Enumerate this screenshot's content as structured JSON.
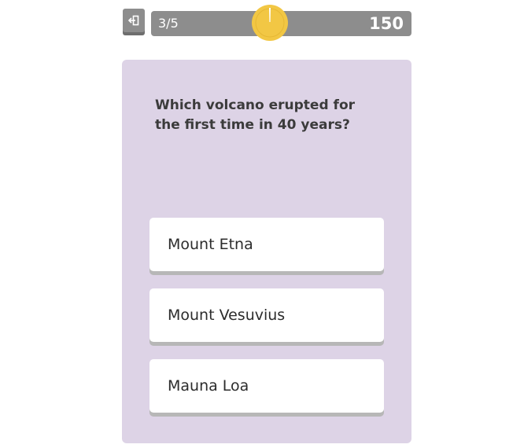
{
  "header": {
    "exit_icon": "exit-icon",
    "question_counter": "3/5",
    "score": "150",
    "timer_icon": "stopwatch-icon",
    "timer_color": "#f2c744",
    "bar_color": "#8d8d8d"
  },
  "question": {
    "text": "Which volcano erupted for the first time in 40 years?",
    "card_color": "#ddd3e6"
  },
  "answers": [
    {
      "label": "Mount Etna"
    },
    {
      "label": "Mount Vesuvius"
    },
    {
      "label": "Mauna Loa"
    }
  ]
}
